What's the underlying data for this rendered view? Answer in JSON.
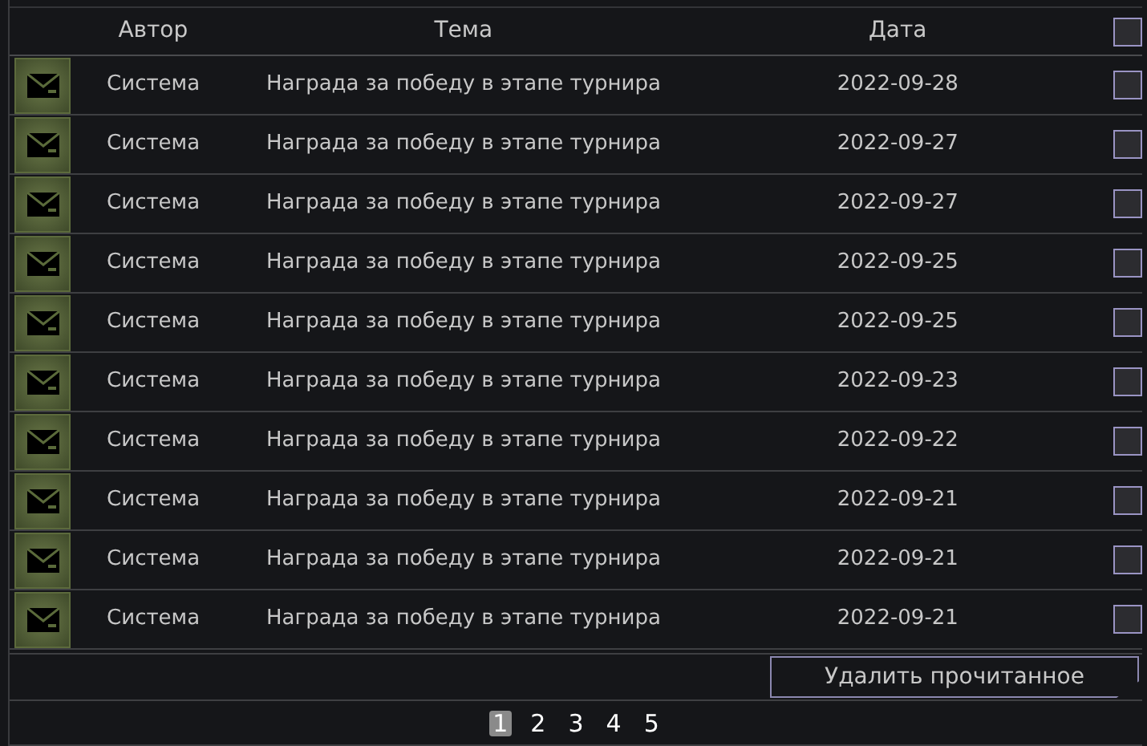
{
  "columns": [
    "Автор",
    "Тема",
    "Дата"
  ],
  "select_all": {
    "checked": false
  },
  "messages": [
    {
      "author": "Система",
      "subject": "Награда за победу в этапе турнира",
      "date": "2022-09-28",
      "checked": false
    },
    {
      "author": "Система",
      "subject": "Награда за победу в этапе турнира",
      "date": "2022-09-27",
      "checked": false
    },
    {
      "author": "Система",
      "subject": "Награда за победу в этапе турнира",
      "date": "2022-09-27",
      "checked": false
    },
    {
      "author": "Система",
      "subject": "Награда за победу в этапе турнира",
      "date": "2022-09-25",
      "checked": false
    },
    {
      "author": "Система",
      "subject": "Награда за победу в этапе турнира",
      "date": "2022-09-25",
      "checked": false
    },
    {
      "author": "Система",
      "subject": "Награда за победу в этапе турнира",
      "date": "2022-09-23",
      "checked": false
    },
    {
      "author": "Система",
      "subject": "Награда за победу в этапе турнира",
      "date": "2022-09-22",
      "checked": false
    },
    {
      "author": "Система",
      "subject": "Награда за победу в этапе турнира",
      "date": "2022-09-21",
      "checked": false
    },
    {
      "author": "Система",
      "subject": "Награда за победу в этапе турнира",
      "date": "2022-09-21",
      "checked": false
    },
    {
      "author": "Система",
      "subject": "Награда за победу в этапе турнира",
      "date": "2022-09-21",
      "checked": false
    }
  ],
  "delete_button": "Удалить прочитанное",
  "pages": [
    {
      "label": "1",
      "selected": true
    },
    {
      "label": "2",
      "selected": false
    },
    {
      "label": "3",
      "selected": false
    },
    {
      "label": "4",
      "selected": false
    },
    {
      "label": "5",
      "selected": false
    }
  ]
}
